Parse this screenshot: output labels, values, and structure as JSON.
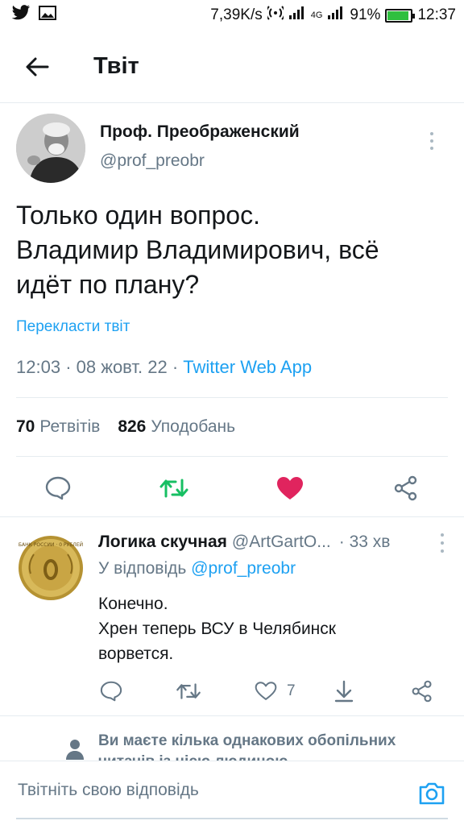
{
  "status_bar": {
    "speed": "7,39K/s",
    "network": "4G",
    "battery": "91%",
    "battery_level": 0.91,
    "time": "12:37"
  },
  "header": {
    "title": "Твіт"
  },
  "tweet": {
    "author_name": "Проф. Преображенский",
    "author_handle": "@prof_preobr",
    "text_lines": [
      "Только один вопрос.",
      "Владимир Владимирович, всё",
      "идёт по плану?"
    ],
    "translate_label": "Перекласти твіт",
    "time": "12:03",
    "date": "08 жовт. 22",
    "source": "Twitter Web App",
    "retweets_count": "70",
    "retweets_label": "Ретвітів",
    "likes_count": "826",
    "likes_label": "Уподобань",
    "colors": {
      "retweet": "#17bf63",
      "like": "#e0245e",
      "link": "#1da1f2"
    }
  },
  "reply": {
    "author_name": "Логика скучная",
    "author_handle": "@ArtGartO...",
    "time": "· 33 хв",
    "reply_to_prefix": "У відповідь",
    "reply_to_handle": "@prof_preobr",
    "text_lines": [
      "Конечно.",
      "Хрен теперь ВСУ в Челябинск",
      "ворвется."
    ],
    "likes_count": "7",
    "coin_text": "БАНК РОССИИ · 0 РУБЛЕЙ"
  },
  "mutual": {
    "text_lines": [
      "Ви маєте кілька однакових обопільних",
      "читачів із цією людиною"
    ]
  },
  "compose": {
    "placeholder": "Твітніть свою відповідь"
  }
}
